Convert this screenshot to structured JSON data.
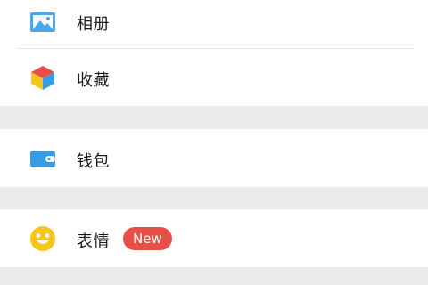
{
  "menu": {
    "album": {
      "label": "相册",
      "icon": "photo-album-icon",
      "icon_color": "#4aa8e8"
    },
    "favorites": {
      "label": "收藏",
      "icon": "cube-icon"
    },
    "wallet": {
      "label": "钱包",
      "icon": "wallet-icon",
      "icon_color": "#3a9be0"
    },
    "stickers": {
      "label": "表情",
      "icon": "smiley-icon",
      "icon_color": "#f5c518",
      "badge": "New",
      "badge_color": "#e84f48"
    }
  },
  "colors": {
    "section_gap": "#ebebeb",
    "divider": "#e6e6e6",
    "text": "#1a1a1a",
    "background": "#ffffff"
  }
}
